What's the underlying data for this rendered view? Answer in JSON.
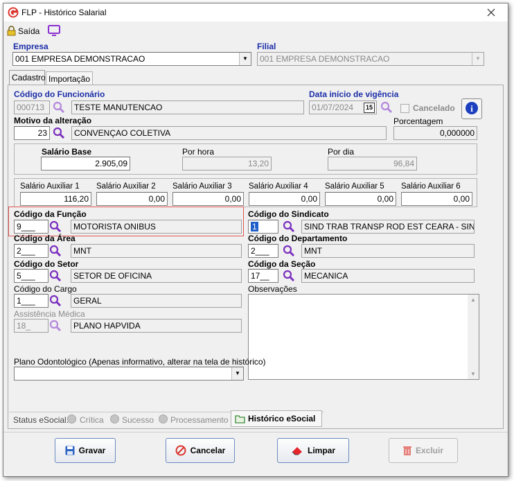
{
  "window": {
    "title": "FLP - Histórico Salarial"
  },
  "toolbar": {
    "saida": "Saída"
  },
  "empresa": {
    "label": "Empresa",
    "value": "001 EMPRESA DEMONSTRACAO"
  },
  "filial": {
    "label": "Filial",
    "value": "001 EMPRESA DEMONSTRACAO"
  },
  "tabs": [
    {
      "label": "Cadastro"
    },
    {
      "label": "Importação"
    }
  ],
  "funcionario": {
    "label": "Código do Funcionário",
    "code": "000713",
    "name": "TESTE MANUTENCAO"
  },
  "vigencia": {
    "label": "Data início de vigência",
    "date": "01/07/2024",
    "calendar": "15"
  },
  "cancelado": {
    "label": "Cancelado"
  },
  "motivo": {
    "label": "Motivo da alteração",
    "code": "23",
    "name": "CONVENÇAO COLETIVA"
  },
  "porcentagem": {
    "label": "Porcentagem",
    "value": "0,000000"
  },
  "salario": {
    "base_label": "Salário Base",
    "base": "2.905,09",
    "hora_label": "Por hora",
    "hora": "13,20",
    "dia_label": "Por dia",
    "dia": "96,84"
  },
  "aux": [
    {
      "label": "Salário Auxiliar 1",
      "value": "116,20"
    },
    {
      "label": "Salário Auxiliar 2",
      "value": "0,00"
    },
    {
      "label": "Salário Auxiliar 3",
      "value": "0,00"
    },
    {
      "label": "Salário Auxiliar 4",
      "value": "0,00"
    },
    {
      "label": "Salário Auxiliar 5",
      "value": "0,00"
    },
    {
      "label": "Salário Auxiliar 6",
      "value": "0,00"
    }
  ],
  "funcao": {
    "label": "Código da Função",
    "code": "9___",
    "name": "MOTORISTA ONIBUS"
  },
  "sindicato": {
    "label": "Código do Sindicato",
    "code": "1",
    "name": "SIND TRAB TRANSP ROD EST CEARA - SINTF"
  },
  "area": {
    "label": "Código da Área",
    "code": "2___",
    "name": "MNT"
  },
  "departamento": {
    "label": "Código do Departamento",
    "code": "2___",
    "name": "MNT"
  },
  "setor": {
    "label": "Código do Setor",
    "code": "5___",
    "name": "SETOR DE OFICINA"
  },
  "secao": {
    "label": "Código da Seção",
    "code": "17__",
    "name": "MECANICA"
  },
  "cargo": {
    "label": "Código do Cargo",
    "code": "1___",
    "name": "GERAL"
  },
  "observacoes": {
    "label": "Observações"
  },
  "assistencia": {
    "label": "Assistência Médica",
    "code": "18_",
    "name": "PLANO HAPVIDA"
  },
  "odonto": {
    "label": "Plano Odontológico (Apenas informativo, alterar na tela de histórico)"
  },
  "esocial": {
    "status_label": "Status eSocial:",
    "critica": "Crítica",
    "sucesso": "Sucesso",
    "processamento": "Processamento",
    "historico": "Histórico eSocial"
  },
  "buttons": {
    "gravar": "Gravar",
    "cancelar": "Cancelar",
    "limpar": "Limpar",
    "excluir": "Excluir"
  },
  "colors": {
    "label_blue": "#1c2ea8",
    "accent_red": "#d9322b",
    "highlight_red": "#e0554f",
    "magnifier": "#7b2fbf"
  }
}
